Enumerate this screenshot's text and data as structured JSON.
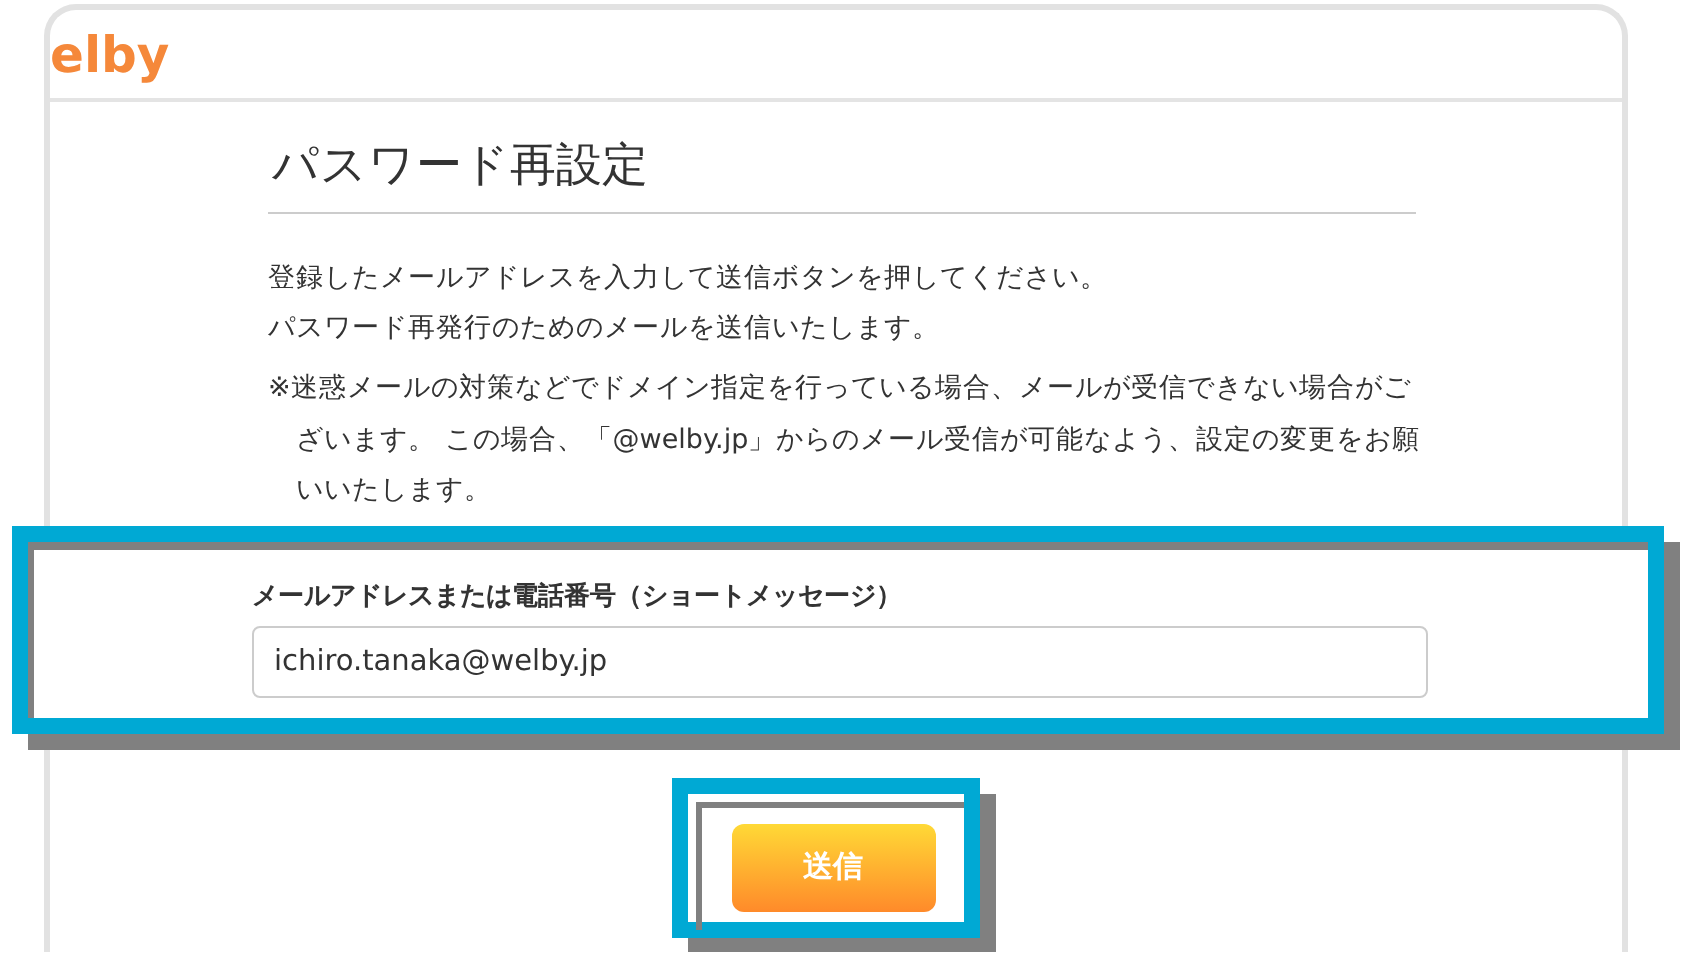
{
  "header": {
    "logo": "elby"
  },
  "page": {
    "title": "パスワード再設定",
    "intro": [
      "登録したメールアドレスを入力して送信ボタンを押してください。",
      "パスワード再発行のためのメールを送信いたします。"
    ],
    "note": "※迷惑メールの対策などでドメイン指定を行っている場合、メールが受信できない場合がございます。 この場合、「@welby.jp」からのメール受信が可能なよう、設定の変更をお願いいたします。"
  },
  "form": {
    "label": "メールアドレスまたは電話番号（ショートメッセージ）",
    "value": "ichiro.tanaka@welby.jp",
    "highlighted": true
  },
  "submit": {
    "label": "送信",
    "highlighted": true
  }
}
